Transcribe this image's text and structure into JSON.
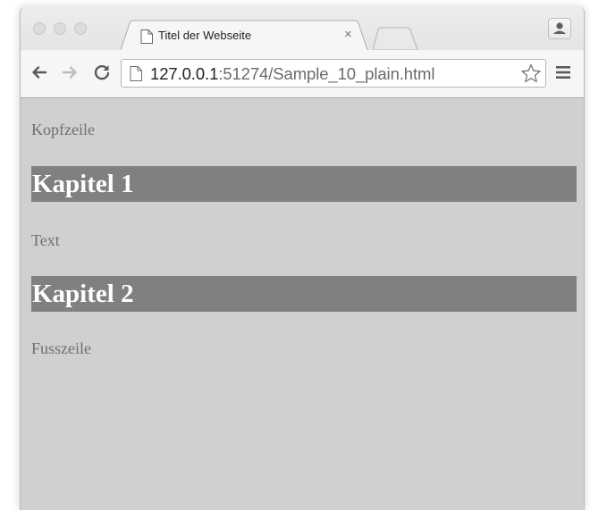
{
  "browser": {
    "tab": {
      "title": "Titel der Webseite",
      "close_glyph": "×",
      "favicon": "page-icon"
    },
    "address_bar": {
      "host": "127.0.0.1",
      "rest": ":51274/Sample_10_plain.html",
      "page_icon": "page-icon"
    },
    "icons": {
      "back": "back-arrow-icon",
      "forward": "forward-arrow-icon",
      "reload": "reload-icon",
      "bookmark": "star-icon",
      "menu": "hamburger-menu-icon",
      "profile": "person-icon"
    }
  },
  "page": {
    "header_text": "Kopfzeile",
    "chapter1": "Kapitel 1",
    "body_text": "Text",
    "chapter2": "Kapitel 2",
    "footer_text": "Fusszeile"
  },
  "colors": {
    "page_background": "#d0d0d0",
    "heading_background": "#808080",
    "heading_text": "#ffffff",
    "body_text": "#6f6f6f"
  }
}
